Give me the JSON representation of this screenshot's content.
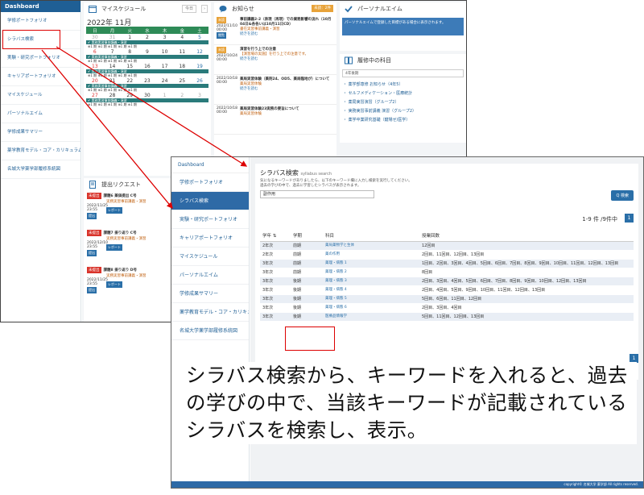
{
  "screen1": {
    "sidebar": {
      "header": "Dashboard",
      "items": [
        "学修ポートフォリオ",
        "シラバス検索",
        "実験・研究ポートフォリオ",
        "キャリアポートフォリオ",
        "マイスケジュール",
        "パーソナルエイム",
        "学修成果サマリー",
        "薬学教育モデル・コア・カリキュラム",
        "名城大学薬学部履修系統図"
      ]
    },
    "calendar": {
      "title": "マイスケジュール",
      "month": "2022年 11月",
      "today_label": "今日",
      "weekdays": [
        "日",
        "月",
        "火",
        "水",
        "木",
        "金",
        "土"
      ],
      "weeks": [
        [
          "30",
          "31",
          "1",
          "2",
          "3",
          "4",
          "5"
        ],
        [
          "6",
          "7",
          "8",
          "9",
          "10",
          "11",
          "12"
        ],
        [
          "13",
          "14",
          "15",
          "16",
          "17",
          "18",
          "19"
        ],
        [
          "20",
          "21",
          "22",
          "23",
          "24",
          "25",
          "26"
        ],
        [
          "27",
          "28",
          "29",
          "30",
          "1",
          "2",
          "3"
        ]
      ],
      "event_label": "✔ 実務実習事前講義・演習",
      "sub_label": "⊕1 期 ⊕1 期 ⊕1 期 ⊕1 期 ⊕1 期"
    },
    "news": {
      "title": "お知らせ",
      "badge": "未読：2件",
      "items": [
        {
          "tag": "未読",
          "date": "2022/11/10",
          "time": "00:00",
          "title": "事前講義2-2（表現（再現）での業務影響の流れ（10月04日&各各いは10月11日CD）",
          "line": "書在実習事前講義・演習",
          "btn": "閲覧",
          "more": "続きを読む"
        },
        {
          "tag": "未読",
          "date": "2022/10/24",
          "time": "00:00",
          "title": "演習を行う上での注意",
          "line": "【演習場の実施】を行う上での注意です。",
          "btn": "",
          "more": "続きを読む"
        },
        {
          "tag": "",
          "date": "2022/10/18",
          "time": "00:00",
          "title": "薬局実習体験（薬剤24、OD5、薬局臨地が）について",
          "line": "薬局実習体験",
          "btn": "",
          "more": "続きを読む"
        },
        {
          "tag": "",
          "date": "2022/10/18",
          "time": "00:00",
          "title": "薬局実習体験23実務の要旨について",
          "line": "薬局実習体験",
          "btn": "",
          "more": ""
        }
      ]
    },
    "personal": {
      "title": "パーソナルエイム",
      "box": "パーソナルエイムで登録した目標がある場合に表示されます。"
    },
    "courses": {
      "title": "履修中の科目",
      "select": "4年後期",
      "items": [
        "・ 薬学部専修 お知らせ（4年5）",
        "・ セルフメディケーション・医療統計",
        "・ 薬局実習演習（グループ2）",
        "・ 実務実習事前講義 演習（グループ2）",
        "・ 薬学卒業研究基礎（鍵場ゼ/医学）"
      ]
    },
    "requests": {
      "title": "提出リクエスト",
      "items": [
        {
          "tag": "未提出",
          "title": "課題6 薬価提出 C号",
          "sub": "実務実習事前講義・演習",
          "date": "2022/11/25",
          "time": "23:55",
          "btn": "レポート",
          "action": "提出"
        },
        {
          "tag": "未提出",
          "title": "課題7 振り返り C号",
          "sub": "実務実習事前講義・演習",
          "date": "2022/12/10",
          "time": "23:55",
          "btn": "レポート",
          "action": "提出"
        },
        {
          "tag": "未提出",
          "title": "課題8 振り返り D号",
          "sub": "実務実習事前講義・演習",
          "date": "2022/11/25",
          "time": "23:55",
          "btn": "レポート",
          "action": "提出"
        }
      ]
    }
  },
  "screen2": {
    "sidebar": {
      "header": "Dashboard",
      "items": [
        "学修ポートフォリオ",
        "シラバス検索",
        "実験・研究ポートフォリオ",
        "キャリアポートフォリオ",
        "マイスケジュール",
        "パーソナルエイム",
        "学修成果サマリー",
        "薬学教育モデル・コア・カリキュラム",
        "名城大学薬学部履修系統図"
      ]
    },
    "title": "シラバス検索",
    "title_en": "syllabus search",
    "desc1": "気になるキーワードがありましたら、以下のキーワード欄に入力し検索を実行してください。",
    "desc2": "過去の学びの中で、過去に学習したシラバスが表示されます。",
    "keyword": "副作用",
    "search_btn": "Q 検索",
    "count": "1-9 件 /9件中",
    "page": "1",
    "columns": [
      "学年 ⇅",
      "学期",
      "科目",
      "授業回数"
    ],
    "rows": [
      {
        "year": "2年次",
        "term": "前期",
        "subject": "薬局薬物学と生体",
        "sessions": "12回目"
      },
      {
        "year": "2年次",
        "term": "前期",
        "subject": "薬の作用",
        "sessions": "2回目、11回目、12回目、13回目"
      },
      {
        "year": "3年次",
        "term": "前期",
        "subject": "薬理・病態 1",
        "sessions": "1回目、2回目、3回目、4回目、5回目、6回目、7回目、8回目、9回目、10回目、11回目、12回目、13回目"
      },
      {
        "year": "3年次",
        "term": "前期",
        "subject": "薬理・病態 2",
        "sessions": "8回目"
      },
      {
        "year": "3年次",
        "term": "後期",
        "subject": "薬理・病態 3",
        "sessions": "2回目、3回目、4回目、5回目、6回目、7回目、8回目、9回目、10回目、12回目、13回目"
      },
      {
        "year": "3年次",
        "term": "後期",
        "subject": "薬理・病態 4",
        "sessions": "2回目、4回目、5回目、9回目、10回目、11回目、12回目、13回目"
      },
      {
        "year": "3年次",
        "term": "後期",
        "subject": "薬理・病態 5",
        "sessions": "5回目、6回目、11回目、12回目"
      },
      {
        "year": "3年次",
        "term": "後期",
        "subject": "薬理・病態 6",
        "sessions": "2回目、3回目、4回目"
      },
      {
        "year": "3年次",
        "term": "後期",
        "subject": "医療品情報学",
        "sessions": "5回目、11回目、12回目、13回目"
      }
    ],
    "footer": "copyright© 名城大学 薬学部 All rights reserved."
  },
  "caption": "シラバス検索から、キーワードを入れると、過去の学びの中で、当該キーワードが記載されているシラバスを検索し、表示。",
  "colors": {
    "primary": "#1f5f95",
    "accent": "#2a6fa8",
    "highlight": "#d00000"
  }
}
